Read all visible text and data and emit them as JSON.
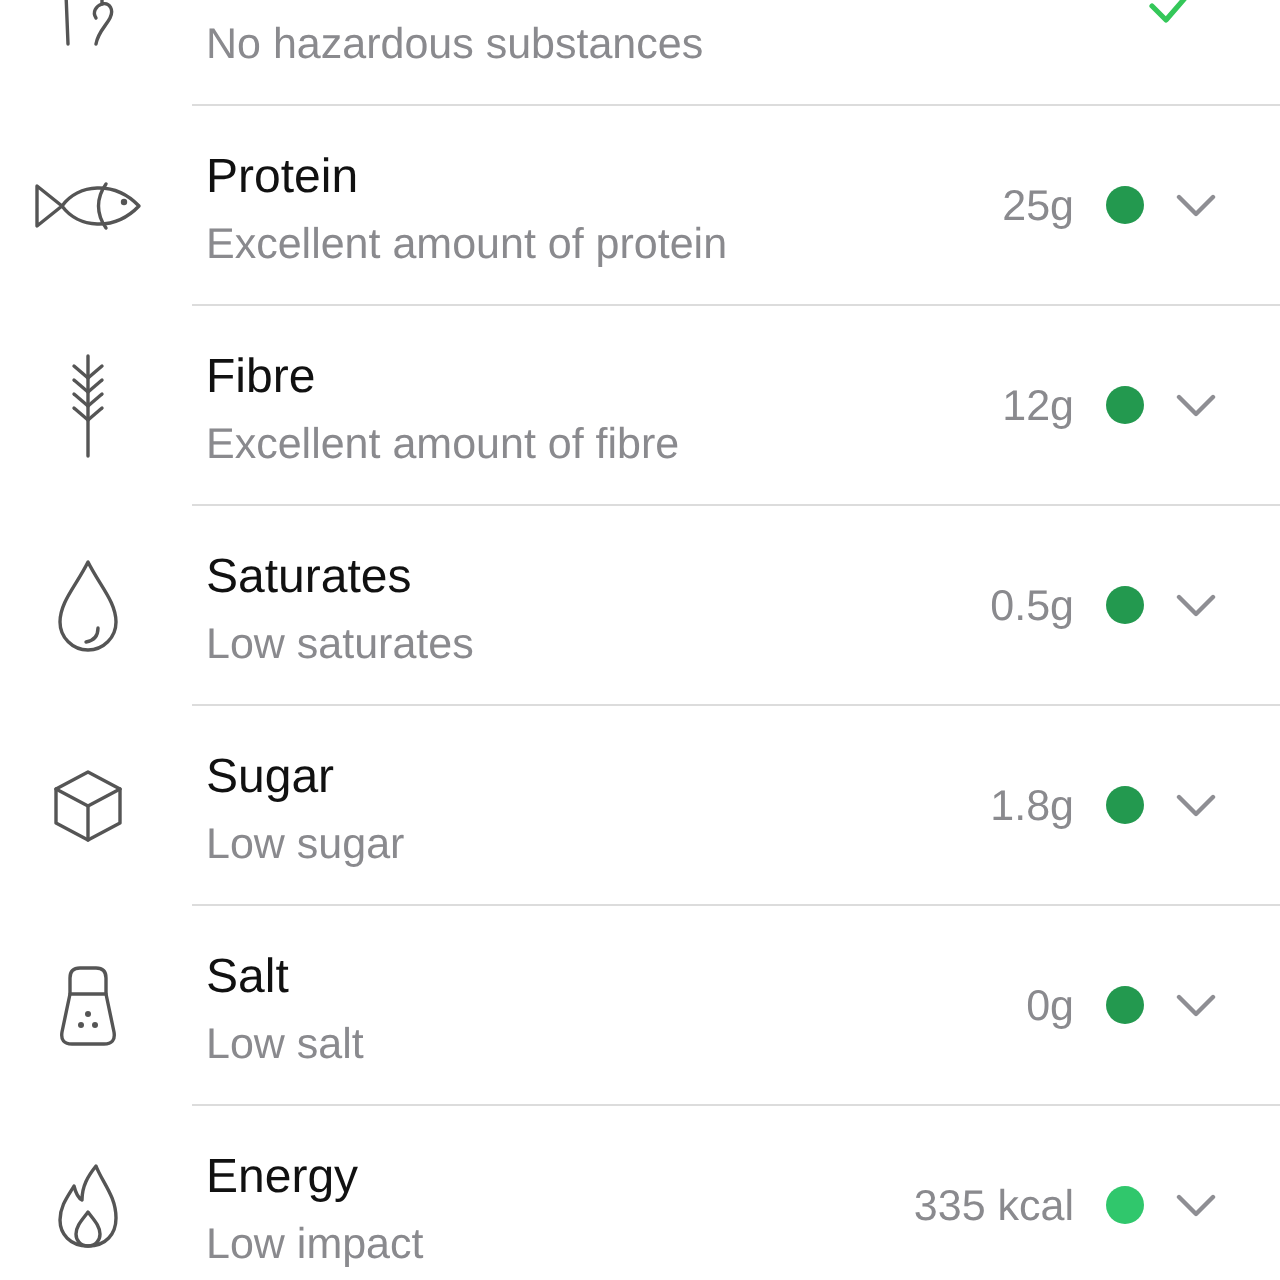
{
  "rows": [
    {
      "kind": "check",
      "subtitle": "No hazardous substances"
    },
    {
      "kind": "nutrient",
      "title": "Protein",
      "subtitle": "Excellent amount of protein",
      "amount": "25g",
      "color": "#23994f",
      "expanded": false
    },
    {
      "kind": "nutrient",
      "title": "Fibre",
      "subtitle": "Excellent amount of fibre",
      "amount": "12g",
      "color": "#23994f",
      "expanded": false
    },
    {
      "kind": "nutrient",
      "title": "Saturates",
      "subtitle": "Low saturates",
      "amount": "0.5g",
      "color": "#23994f",
      "expanded": false
    },
    {
      "kind": "nutrient",
      "title": "Sugar",
      "subtitle": "Low sugar",
      "amount": "1.8g",
      "color": "#23994f",
      "expanded": false
    },
    {
      "kind": "nutrient",
      "title": "Salt",
      "subtitle": "Low salt",
      "amount": "0g",
      "color": "#23994f",
      "expanded": false
    },
    {
      "kind": "nutrient",
      "title": "Energy",
      "subtitle": "Low impact",
      "amount": "335 kcal",
      "color": "#30c76c",
      "expanded": false
    }
  ]
}
